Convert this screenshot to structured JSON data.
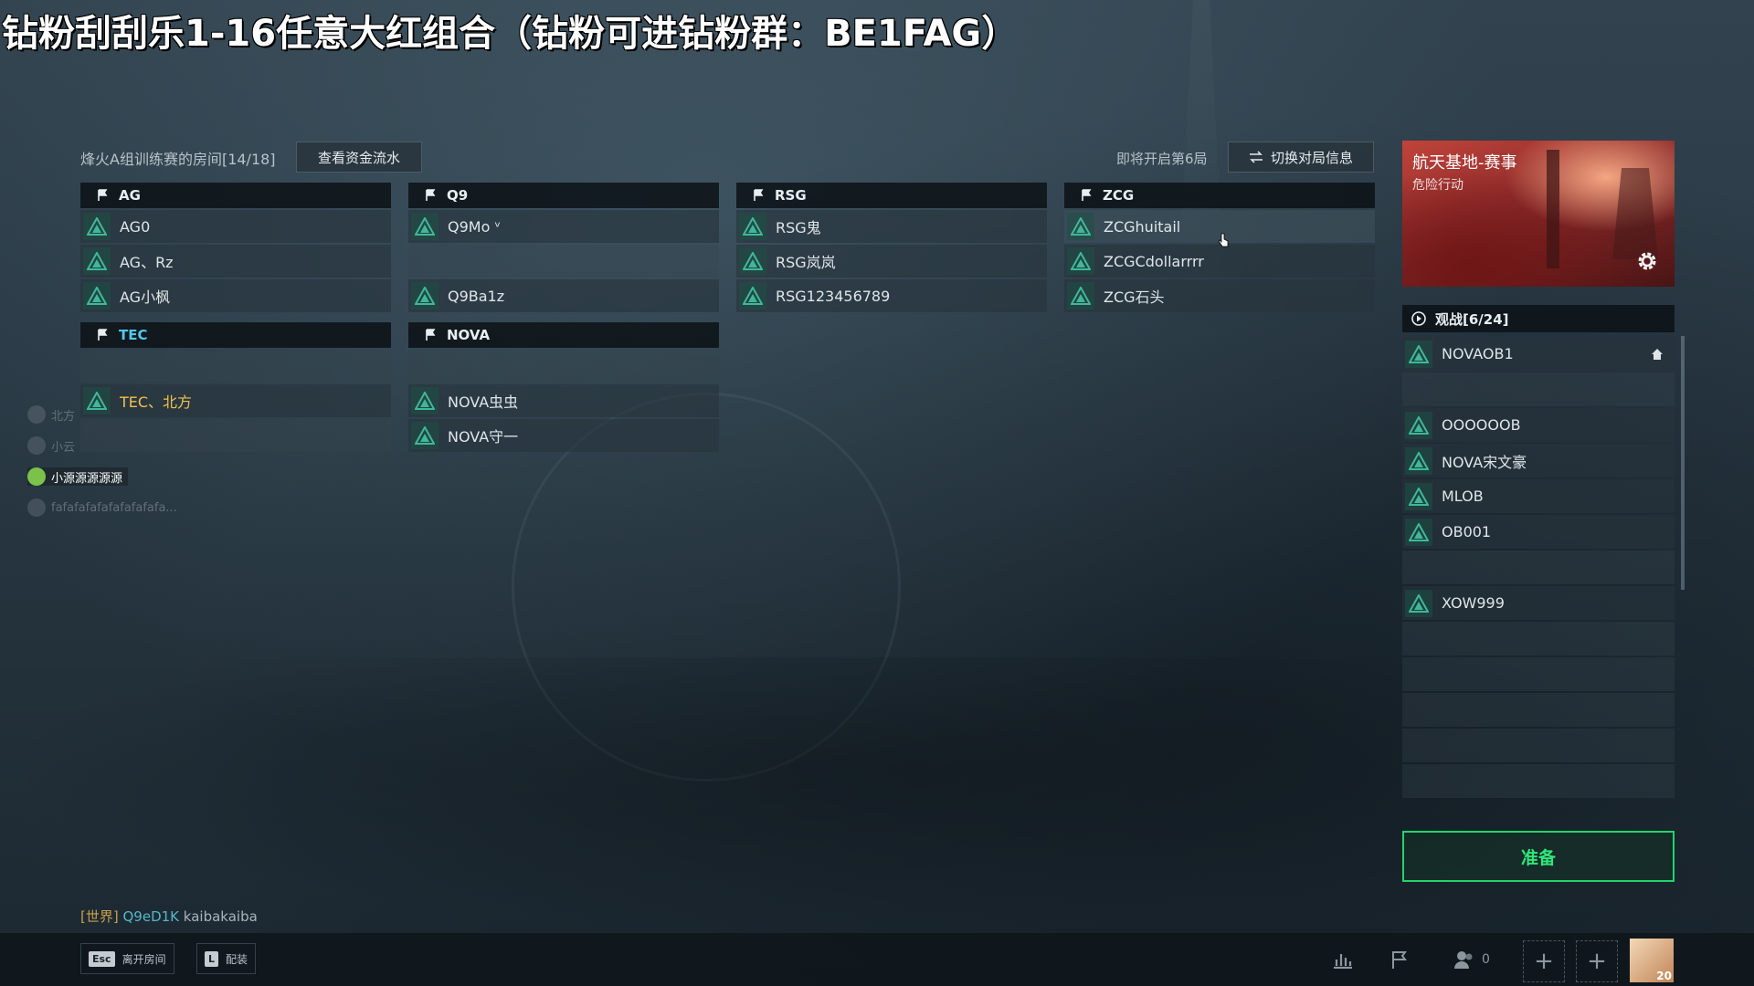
{
  "overlay_title": "钻粉刮刮乐1-16任意大红组合（钻粉可进钻粉群：BE1FAG）",
  "room": {
    "title": "烽火A组训练赛的房间[14/18]",
    "funds_button": "查看资金流水",
    "next_round": "即将开启第6局",
    "switch_button": "切换对局信息"
  },
  "teams": [
    {
      "name": "AG",
      "players": [
        "AG0",
        "AG、Rz",
        "AG小枫"
      ]
    },
    {
      "name": "Q9",
      "players": [
        "Q9Mo ᵛ",
        "",
        "Q9Ba1z"
      ]
    },
    {
      "name": "RSG",
      "players": [
        "RSG鬼",
        "RSG岚岚",
        "RSG123456789"
      ]
    },
    {
      "name": "ZCG",
      "players": [
        "ZCGhuitail",
        "ZCGCdollarrrr",
        "ZCG石头"
      ]
    },
    {
      "name": "TEC",
      "players": [
        "",
        "TEC、北方",
        ""
      ]
    },
    {
      "name": "NOVA",
      "players": [
        "",
        "NOVA虫虫",
        "NOVA守一"
      ]
    }
  ],
  "map": {
    "name": "航天基地-赛事",
    "mode": "危险行动",
    "settings_icon": "gear-icon"
  },
  "spectators": {
    "title": "观战[6/24]",
    "slots": [
      "NOVAOB1",
      "",
      "OOOOOOB",
      "NOVA宋文豪",
      "MLOB",
      "OB001",
      "",
      "XOW999",
      "",
      "",
      "",
      "",
      ""
    ]
  },
  "ready_button": "准备",
  "voice_chat": [
    {
      "name": "北方"
    },
    {
      "name": "小云"
    },
    {
      "name": "小源源源源源"
    },
    {
      "name": "fafafafafafafafafafa..."
    }
  ],
  "world_chat": {
    "tag": "[世界]",
    "name": "Q9eD1K",
    "message": "kaibakaiba"
  },
  "bottom": {
    "esc_key": "Esc",
    "esc_label": "离开房间",
    "l_key": "L",
    "l_label": "配装",
    "friends_count": "0",
    "avatar_level": "20"
  },
  "colors": {
    "accent_green": "#22d46a",
    "highlight": "#f2c14e",
    "rank_teal": "#3fb89a"
  }
}
